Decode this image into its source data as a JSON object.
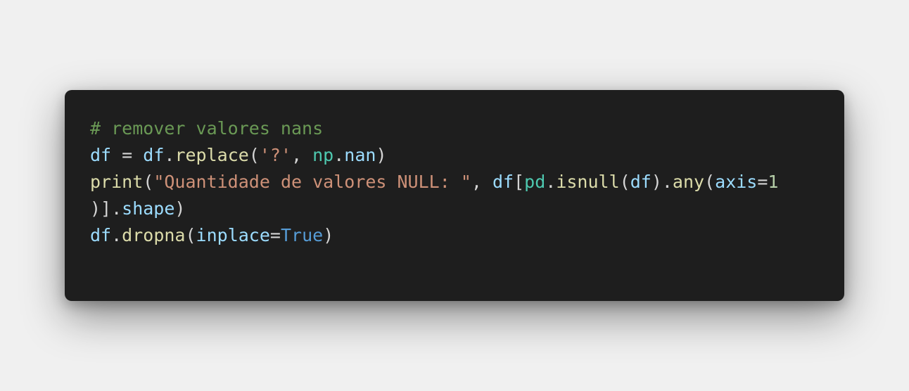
{
  "colors": {
    "page_background": "#f0f0f0",
    "editor_background": "#1e1e1e",
    "comment": "#6a9955",
    "variable": "#9cdcfe",
    "function": "#dcdcaa",
    "string": "#ce9178",
    "module": "#4ec9b0",
    "keyword_constant": "#569cd6",
    "number": "#b5cea8",
    "plain": "#d4d4d4"
  },
  "code": {
    "language": "python",
    "lines": [
      [
        {
          "text": "# remover valores nans",
          "color": "#6a9955"
        }
      ],
      [
        {
          "text": "df",
          "color": "#9cdcfe"
        },
        {
          "text": " = ",
          "color": "#d4d4d4"
        },
        {
          "text": "df",
          "color": "#9cdcfe"
        },
        {
          "text": ".",
          "color": "#d4d4d4"
        },
        {
          "text": "replace",
          "color": "#dcdcaa"
        },
        {
          "text": "(",
          "color": "#d4d4d4"
        },
        {
          "text": "'?'",
          "color": "#ce9178"
        },
        {
          "text": ", ",
          "color": "#d4d4d4"
        },
        {
          "text": "np",
          "color": "#4ec9b0"
        },
        {
          "text": ".",
          "color": "#d4d4d4"
        },
        {
          "text": "nan",
          "color": "#9cdcfe"
        },
        {
          "text": ")",
          "color": "#d4d4d4"
        }
      ],
      [
        {
          "text": "print",
          "color": "#dcdcaa"
        },
        {
          "text": "(",
          "color": "#d4d4d4"
        },
        {
          "text": "\"Quantidade de valores NULL: \"",
          "color": "#ce9178"
        },
        {
          "text": ", ",
          "color": "#d4d4d4"
        },
        {
          "text": "df",
          "color": "#9cdcfe"
        },
        {
          "text": "[",
          "color": "#d4d4d4"
        },
        {
          "text": "pd",
          "color": "#4ec9b0"
        },
        {
          "text": ".",
          "color": "#d4d4d4"
        },
        {
          "text": "isnull",
          "color": "#dcdcaa"
        },
        {
          "text": "(",
          "color": "#d4d4d4"
        },
        {
          "text": "df",
          "color": "#9cdcfe"
        },
        {
          "text": ").",
          "color": "#d4d4d4"
        },
        {
          "text": "any",
          "color": "#dcdcaa"
        },
        {
          "text": "(",
          "color": "#d4d4d4"
        },
        {
          "text": "axis",
          "color": "#9cdcfe"
        },
        {
          "text": "=",
          "color": "#d4d4d4"
        },
        {
          "text": "1",
          "color": "#b5cea8"
        }
      ],
      [
        {
          "text": ")].",
          "color": "#d4d4d4"
        },
        {
          "text": "shape",
          "color": "#9cdcfe"
        },
        {
          "text": ")",
          "color": "#d4d4d4"
        }
      ],
      [
        {
          "text": "df",
          "color": "#9cdcfe"
        },
        {
          "text": ".",
          "color": "#d4d4d4"
        },
        {
          "text": "dropna",
          "color": "#dcdcaa"
        },
        {
          "text": "(",
          "color": "#d4d4d4"
        },
        {
          "text": "inplace",
          "color": "#9cdcfe"
        },
        {
          "text": "=",
          "color": "#d4d4d4"
        },
        {
          "text": "True",
          "color": "#569cd6"
        },
        {
          "text": ")",
          "color": "#d4d4d4"
        }
      ]
    ]
  }
}
